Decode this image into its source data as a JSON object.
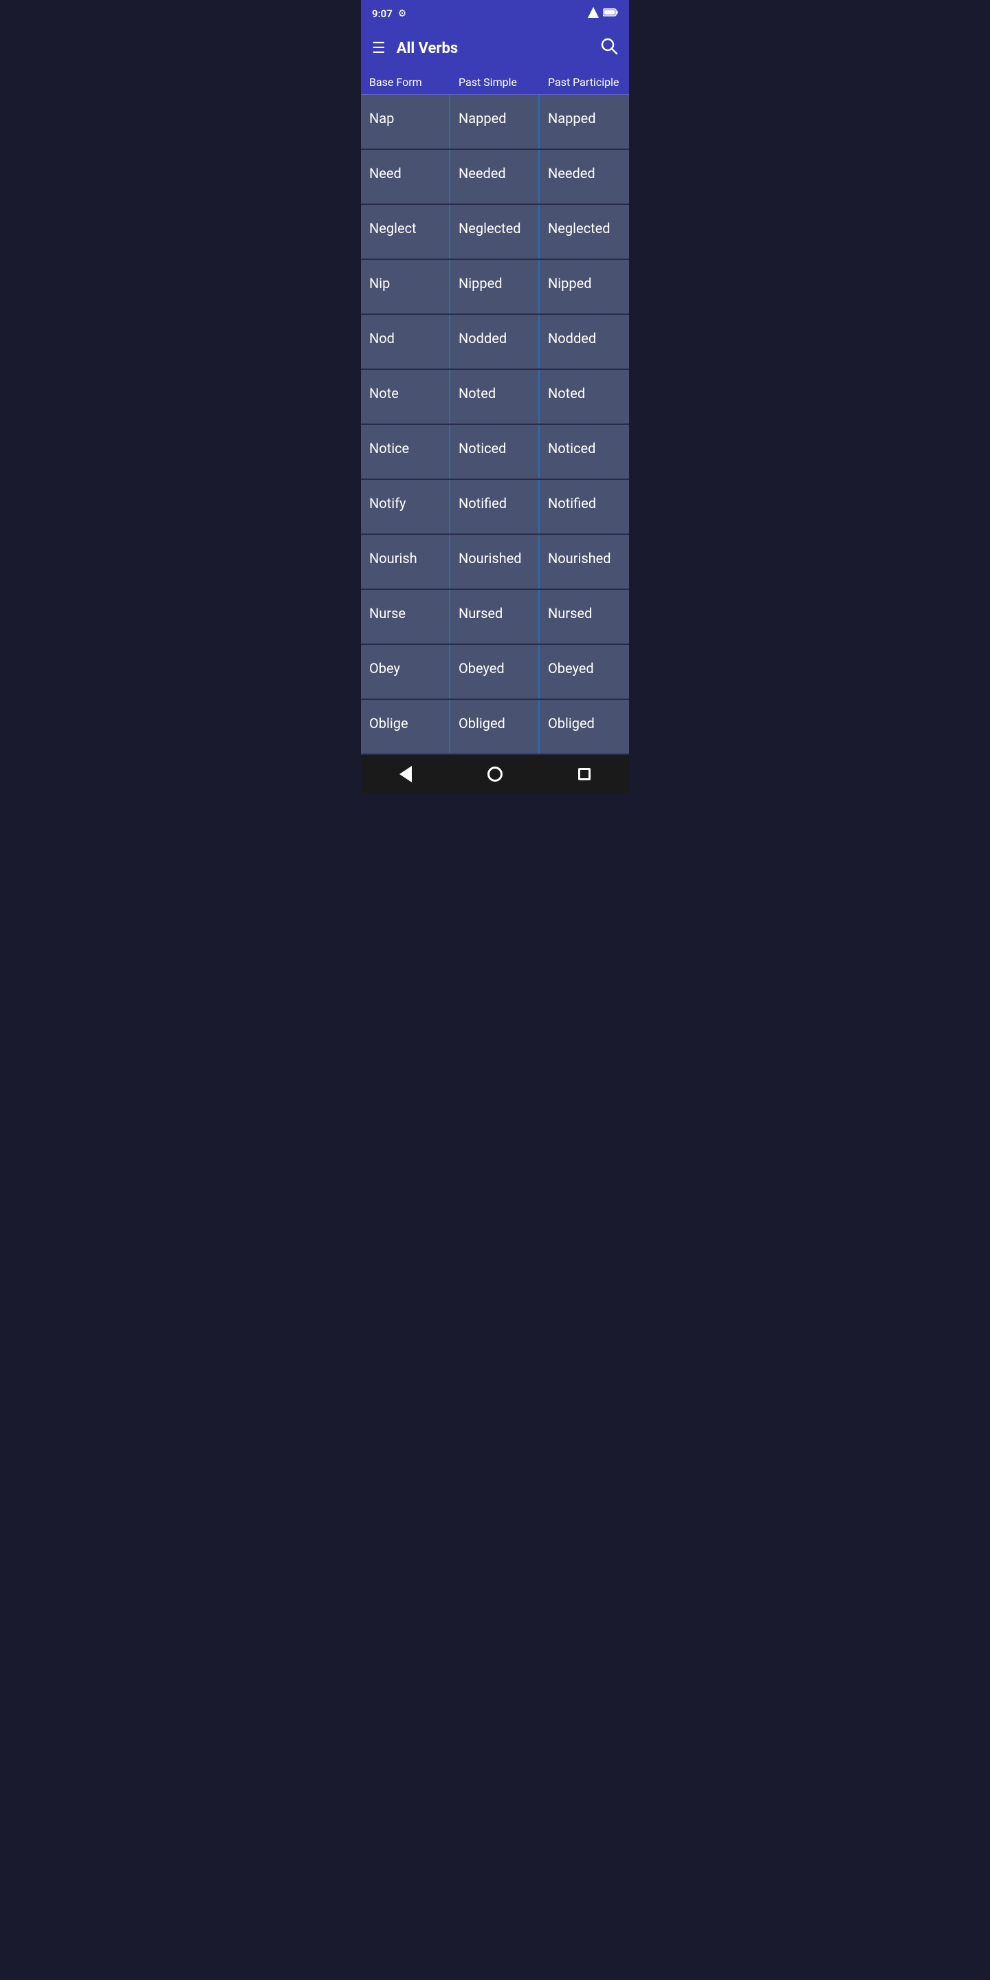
{
  "statusBar": {
    "time": "9:07",
    "gearIcon": "⚙",
    "signalIcon": "▲",
    "batteryIcon": "🔋"
  },
  "appBar": {
    "title": "All Verbs",
    "hamburgerIcon": "☰",
    "searchIcon": "🔍"
  },
  "columns": {
    "col1": "Base Form",
    "col2": "Past Simple",
    "col3": "Past Participle"
  },
  "verbs": [
    {
      "base": "Nap",
      "pastSimple": "Napped",
      "pastParticiple": "Napped"
    },
    {
      "base": "Need",
      "pastSimple": "Needed",
      "pastParticiple": "Needed"
    },
    {
      "base": "Neglect",
      "pastSimple": "Neglected",
      "pastParticiple": "Neglected"
    },
    {
      "base": "Nip",
      "pastSimple": "Nipped",
      "pastParticiple": "Nipped"
    },
    {
      "base": "Nod",
      "pastSimple": "Nodded",
      "pastParticiple": "Nodded"
    },
    {
      "base": "Note",
      "pastSimple": "Noted",
      "pastParticiple": "Noted"
    },
    {
      "base": "Notice",
      "pastSimple": "Noticed",
      "pastParticiple": "Noticed"
    },
    {
      "base": "Notify",
      "pastSimple": "Notified",
      "pastParticiple": "Notified"
    },
    {
      "base": "Nourish",
      "pastSimple": "Nourished",
      "pastParticiple": "Nourished"
    },
    {
      "base": "Nurse",
      "pastSimple": "Nursed",
      "pastParticiple": "Nursed"
    },
    {
      "base": "Obey",
      "pastSimple": "Obeyed",
      "pastParticiple": "Obeyed"
    },
    {
      "base": "Oblige",
      "pastSimple": "Obliged",
      "pastParticiple": "Obliged"
    }
  ]
}
